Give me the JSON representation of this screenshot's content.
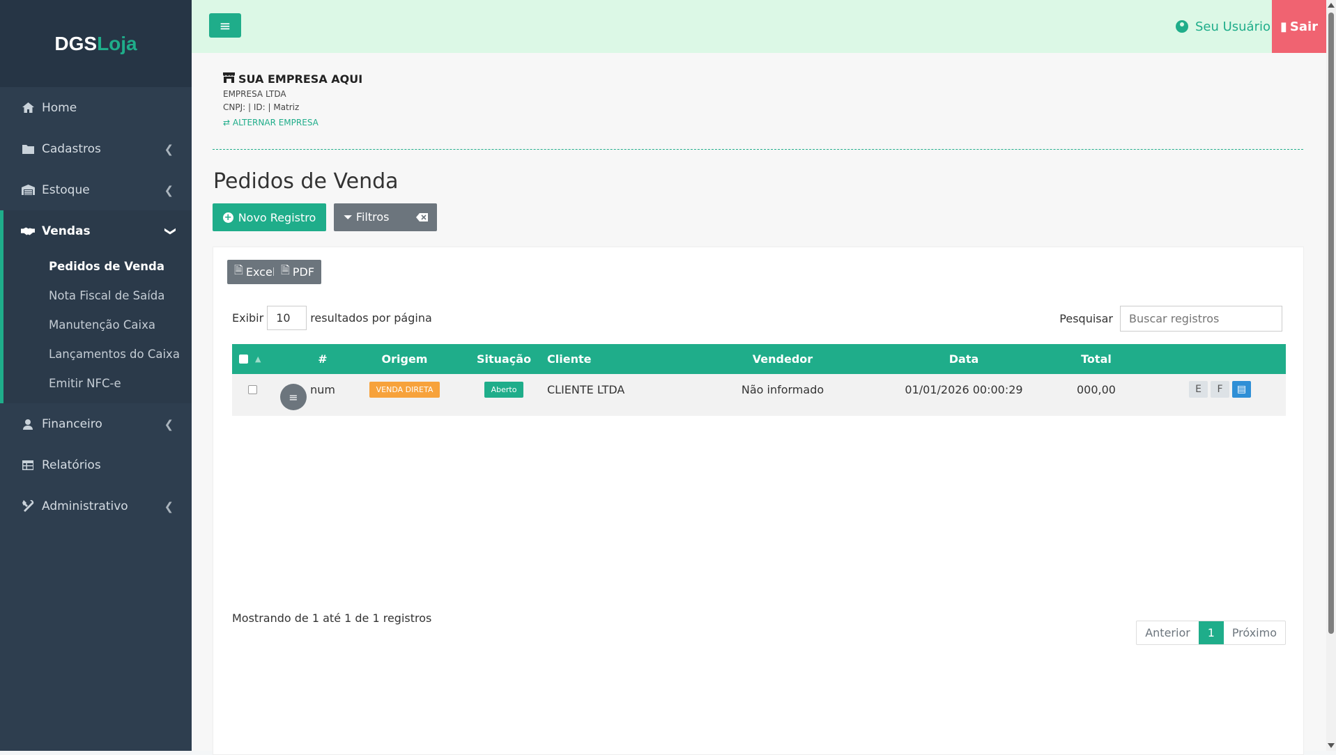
{
  "brand": {
    "part1": "DGS",
    "part2": "Loja"
  },
  "sidebar": {
    "items": [
      {
        "label": "Home",
        "icon": "home-icon"
      },
      {
        "label": "Cadastros",
        "icon": "folder-icon"
      },
      {
        "label": "Estoque",
        "icon": "warehouse-icon"
      },
      {
        "label": "Vendas",
        "icon": "handshake-icon"
      },
      {
        "label": "Financeiro",
        "icon": "user-money-icon"
      },
      {
        "label": "Relatórios",
        "icon": "table-icon"
      },
      {
        "label": "Administrativo",
        "icon": "tools-icon"
      }
    ],
    "vendas_sub": [
      "Pedidos de Venda",
      "Nota Fiscal de Saída",
      "Manutenção Caixa",
      "Lançamentos do Caixa",
      "Emitir NFC-e"
    ]
  },
  "topbar": {
    "user_label": "Seu Usuário",
    "logout_label": "Sair"
  },
  "company": {
    "name": "SUA EMPRESA AQUI",
    "legal_name": "EMPRESA LTDA",
    "details": "CNPJ: | ID: | Matriz",
    "switch_label": "ALTERNAR EMPRESA"
  },
  "page": {
    "title": "Pedidos de Venda",
    "new_button": "Novo Registro",
    "filter_button": "Filtros",
    "excel_button": "Excel",
    "pdf_button": "PDF",
    "show_prefix": "Exibir",
    "page_size": "10",
    "show_suffix": "resultados por página",
    "search_label": "Pesquisar",
    "search_placeholder": "Buscar registros"
  },
  "table": {
    "headers": {
      "num": "#",
      "origem": "Origem",
      "situacao": "Situação",
      "cliente": "Cliente",
      "vendedor": "Vendedor",
      "data": "Data",
      "total": "Total"
    },
    "rows": [
      {
        "num": "num",
        "origem": "VENDA DIRETA",
        "situacao": "Aberto",
        "cliente": "CLIENTE LTDA",
        "vendedor": "Não informado",
        "data": "01/01/2026 00:00:29",
        "total": "000,00",
        "actions": [
          "E",
          "F"
        ]
      }
    ]
  },
  "footer": {
    "info": "Mostrando de 1 até 1 de 1 registros",
    "prev": "Anterior",
    "current_page": "1",
    "next": "Próximo"
  },
  "colors": {
    "accent": "#1fad8a",
    "sidebar": "#2e3e4f",
    "topbar": "#dcf8e6",
    "logout": "#f06371",
    "badge_origem": "#f7a23b"
  }
}
